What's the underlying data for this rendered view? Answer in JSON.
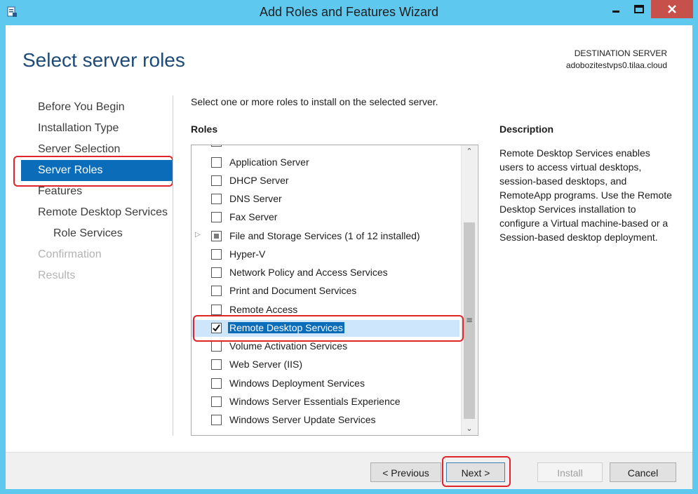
{
  "window": {
    "title": "Add Roles and Features Wizard"
  },
  "header": {
    "page_title": "Select server roles",
    "destination_label": "DESTINATION SERVER",
    "destination_server": "adobozitestvps0.tilaa.cloud"
  },
  "nav": {
    "items": [
      {
        "label": "Before You Begin",
        "state": "normal"
      },
      {
        "label": "Installation Type",
        "state": "normal"
      },
      {
        "label": "Server Selection",
        "state": "normal"
      },
      {
        "label": "Server Roles",
        "state": "active"
      },
      {
        "label": "Features",
        "state": "normal"
      },
      {
        "label": "Remote Desktop Services",
        "state": "normal"
      },
      {
        "label": "Role Services",
        "state": "sub"
      },
      {
        "label": "Confirmation",
        "state": "disabled"
      },
      {
        "label": "Results",
        "state": "disabled"
      }
    ]
  },
  "main": {
    "instruction": "Select one or more roles to install on the selected server.",
    "roles_heading": "Roles",
    "roles": [
      {
        "label": "Application Server",
        "checked": false
      },
      {
        "label": "DHCP Server",
        "checked": false
      },
      {
        "label": "DNS Server",
        "checked": false
      },
      {
        "label": "Fax Server",
        "checked": false
      },
      {
        "label": "File and Storage Services (1 of 12 installed)",
        "checked": "partial",
        "expandable": true
      },
      {
        "label": "Hyper-V",
        "checked": false
      },
      {
        "label": "Network Policy and Access Services",
        "checked": false
      },
      {
        "label": "Print and Document Services",
        "checked": false
      },
      {
        "label": "Remote Access",
        "checked": false
      },
      {
        "label": "Remote Desktop Services",
        "checked": true,
        "selected": true
      },
      {
        "label": "Volume Activation Services",
        "checked": false
      },
      {
        "label": "Web Server (IIS)",
        "checked": false
      },
      {
        "label": "Windows Deployment Services",
        "checked": false
      },
      {
        "label": "Windows Server Essentials Experience",
        "checked": false
      },
      {
        "label": "Windows Server Update Services",
        "checked": false
      }
    ]
  },
  "description": {
    "heading": "Description",
    "text": "Remote Desktop Services enables users to access virtual desktops, session-based desktops, and RemoteApp programs. Use the Remote Desktop Services installation to configure a Virtual machine-based or a Session-based desktop deployment."
  },
  "footer": {
    "previous_label": "< Previous",
    "next_label": "Next >",
    "install_label": "Install",
    "cancel_label": "Cancel"
  },
  "colors": {
    "accent": "#0b6cba",
    "title_bar": "#5ec8ee",
    "highlight_box": "#e0242a"
  }
}
